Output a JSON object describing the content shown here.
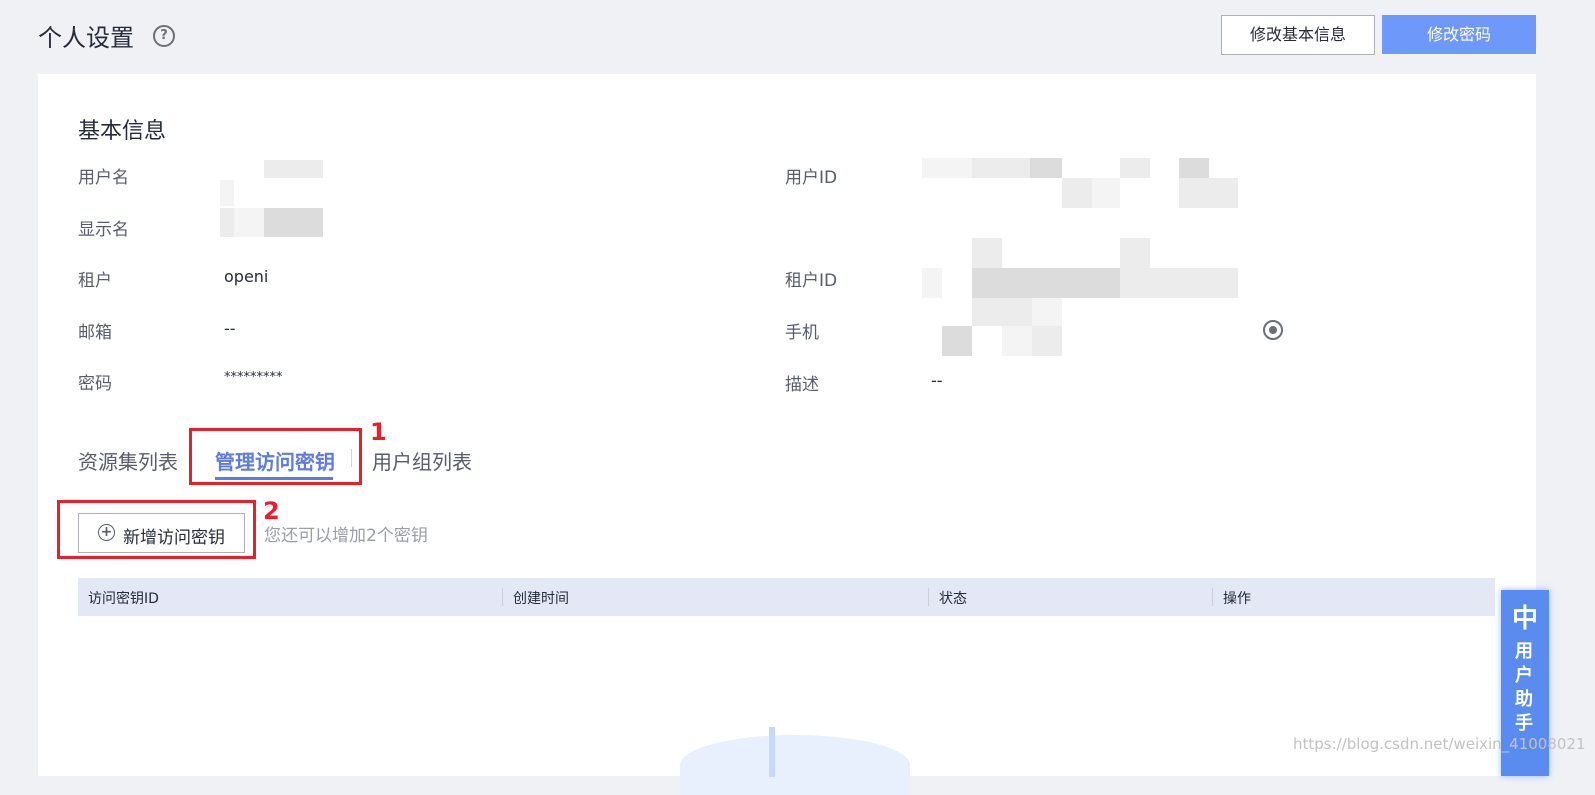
{
  "header": {
    "title": "个人设置",
    "help_icon": "?",
    "edit_info_label": "修改基本信息",
    "change_password_label": "修改密码"
  },
  "basic_info": {
    "section_title": "基本信息",
    "username_label": "用户名",
    "display_name_label": "显示名",
    "tenant_label": "租户",
    "tenant_value": "openi",
    "email_label": "邮箱",
    "email_value": "--",
    "password_label": "密码",
    "password_value": "*********",
    "user_id_label": "用户ID",
    "tenant_id_label": "租户ID",
    "phone_label": "手机",
    "description_label": "描述",
    "description_value": "--"
  },
  "tabs": [
    {
      "label": "资源集列表",
      "active": false
    },
    {
      "label": "管理访问密钥",
      "active": true
    },
    {
      "label": "用户组列表",
      "active": false
    }
  ],
  "annotations": {
    "step1": "1",
    "step2": "2"
  },
  "access_keys": {
    "add_button_label": "新增访问密钥",
    "hint": "您还可以增加2个密钥",
    "columns": [
      "访问密钥ID",
      "创建时间",
      "状态",
      "操作"
    ]
  },
  "assistant": {
    "glyph": "中",
    "label": "用户助手"
  },
  "watermark": "https://blog.csdn.net/weixin_41008021",
  "colors": {
    "accent": "#5e7ce0",
    "primary_button": "#6e98f9",
    "annotation_red": "#e8202a"
  }
}
